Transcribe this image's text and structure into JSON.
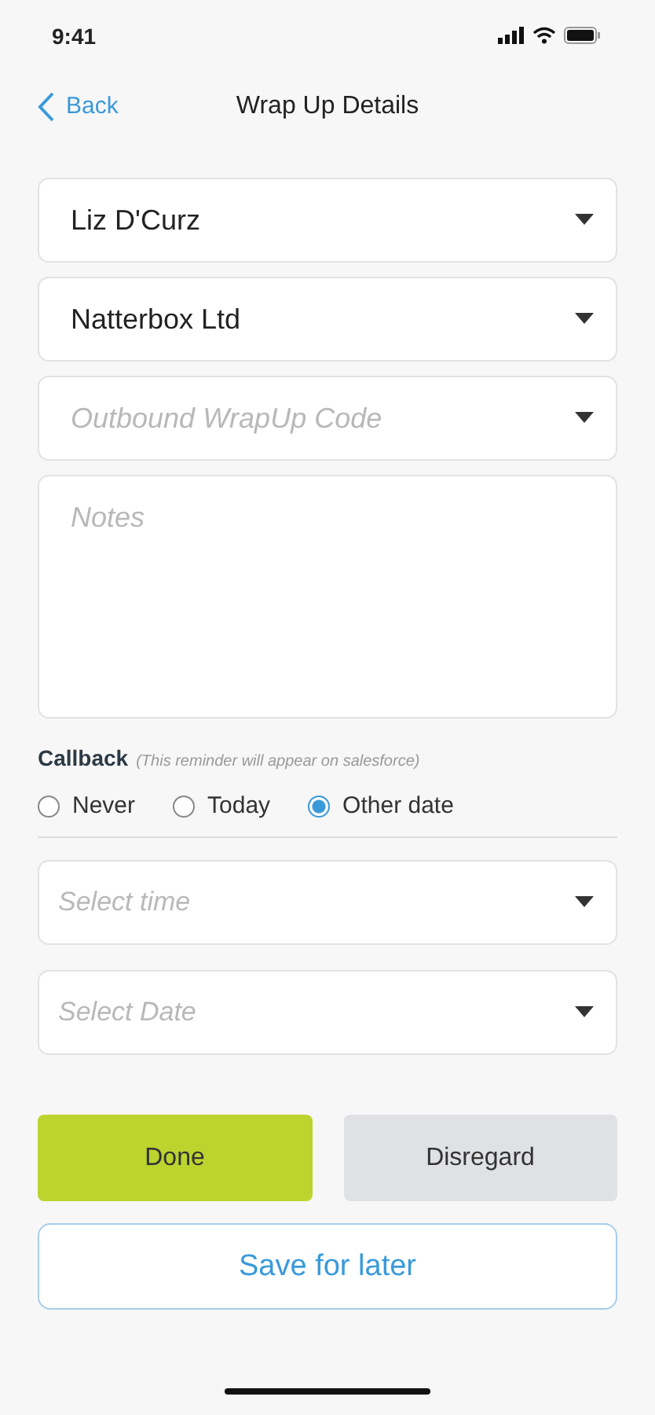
{
  "status_bar": {
    "time": "9:41"
  },
  "nav": {
    "back": "Back",
    "title": "Wrap Up Details"
  },
  "dropdowns": [
    {
      "value": "Liz D'Curz"
    },
    {
      "value": "Natterbox Ltd"
    },
    {
      "placeholder": "Outbound WrapUp Code"
    }
  ],
  "notes": {
    "placeholder": "Notes"
  },
  "callback": {
    "label": "Callback",
    "hint": "(This reminder will appear on salesforce)",
    "options": [
      {
        "label": "Never",
        "selected": false
      },
      {
        "label": "Today",
        "selected": false
      },
      {
        "label": "Other date",
        "selected": true
      }
    ]
  },
  "schedule": [
    {
      "placeholder": "Select time"
    },
    {
      "placeholder": "Select Date"
    }
  ],
  "buttons": {
    "done": "Done",
    "disregard": "Disregard",
    "save": "Save for later"
  }
}
